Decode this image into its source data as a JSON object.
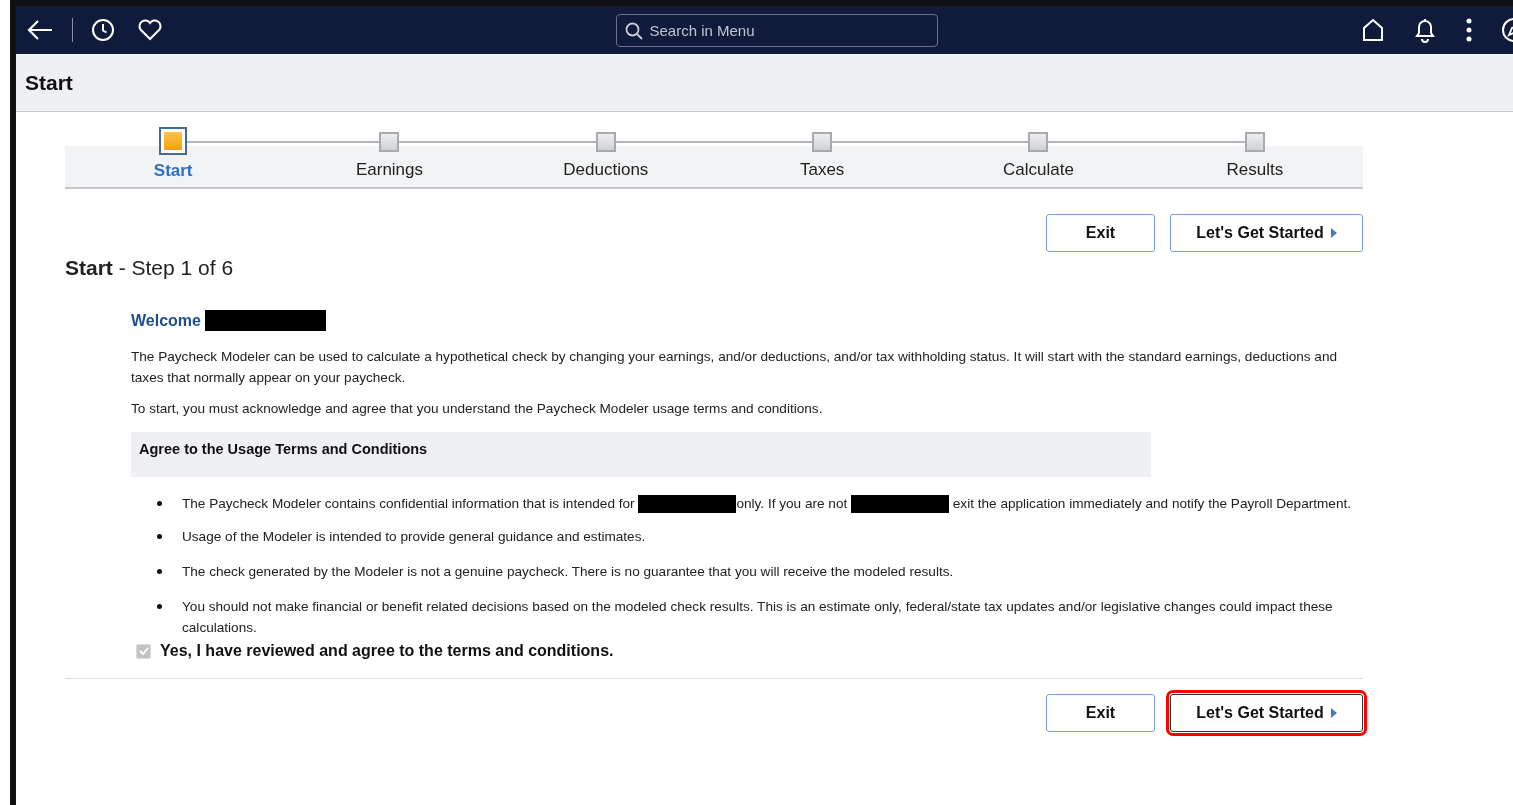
{
  "header": {
    "search": {
      "placeholder": "Search in Menu"
    }
  },
  "page_title": "Start",
  "steps": [
    {
      "label": "Start",
      "selected": true
    },
    {
      "label": "Earnings",
      "selected": false
    },
    {
      "label": "Deductions",
      "selected": false
    },
    {
      "label": "Taxes",
      "selected": false
    },
    {
      "label": "Calculate",
      "selected": false
    },
    {
      "label": "Results",
      "selected": false
    }
  ],
  "top_buttons": [
    {
      "label": "Exit",
      "kind": "plain",
      "highlighted": false
    },
    {
      "label": "Let's Get Started",
      "kind": "next",
      "highlighted": false
    }
  ],
  "step_heading": {
    "title": "Start",
    "subtitle": "- Step 1 of 6"
  },
  "welcome": {
    "label": "Welcome",
    "redacted": true
  },
  "intro": [
    "The Paycheck Modeler can be used to calculate a hypothetical check by changing your earnings, and/or deductions, and/or tax withholding status. It will start with the standard earnings, deductions and taxes that normally appear on your paycheck.",
    "To start, you must acknowledge and agree that you understand the Paycheck Modeler usage terms and conditions."
  ],
  "terms_heading": "Agree to the Usage Terms and Conditions",
  "terms": [
    [
      {
        "kind": "text",
        "text": "The Paycheck Modeler contains confidential information that is intended for "
      },
      {
        "kind": "redacted"
      },
      {
        "kind": "text",
        "text": "only. If you are not "
      },
      {
        "kind": "redacted"
      },
      {
        "kind": "text",
        "text": " exit the application immediately and notify the Payroll Department."
      }
    ],
    [
      {
        "kind": "text",
        "text": "Usage of the Modeler is intended to provide general guidance and estimates."
      }
    ],
    [
      {
        "kind": "text",
        "text": "The check generated by the Modeler is not a genuine paycheck. There is no guarantee that you will receive the modeled results."
      }
    ],
    [
      {
        "kind": "text",
        "text": "You should not make financial or benefit related decisions based on the modeled check results. This is an estimate only, federal/state tax updates and/or legislative changes could impact these calculations."
      }
    ]
  ],
  "agreement": {
    "label": "Yes, I have reviewed and agree to the terms and conditions.",
    "checked": true,
    "disabled": true
  },
  "bottom_buttons": [
    {
      "label": "Exit",
      "kind": "plain",
      "highlighted": false
    },
    {
      "label": "Let's Get Started",
      "kind": "next",
      "highlighted": true
    }
  ]
}
